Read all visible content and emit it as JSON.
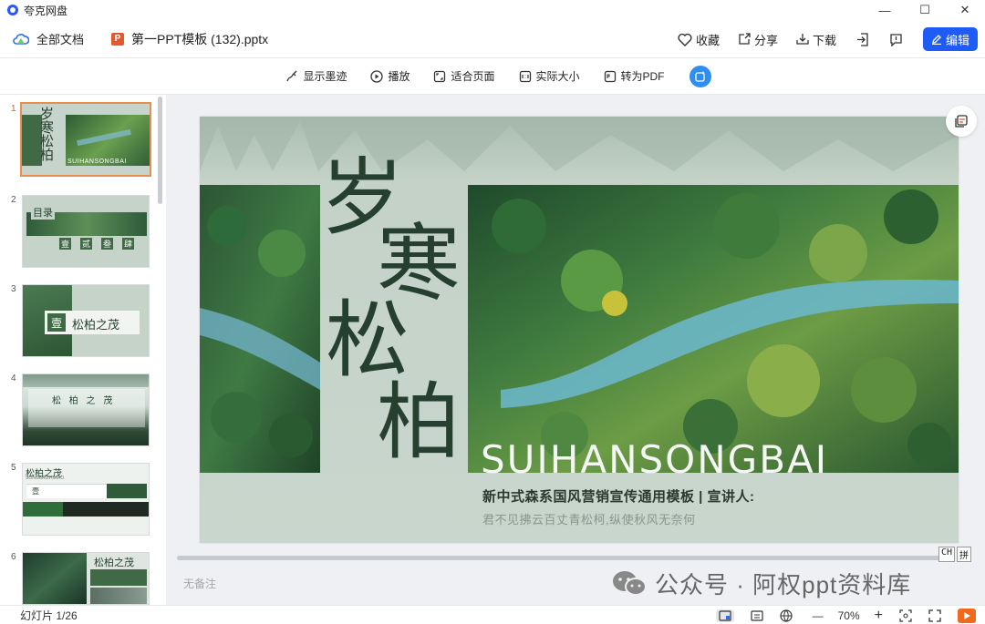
{
  "titlebar": {
    "app_name": "夸克网盘"
  },
  "window_controls": {
    "minimize": "—",
    "maximize": "☐",
    "close": "✕"
  },
  "header": {
    "all_docs": "全部文档",
    "file_name": "第一PPT模板 (132).pptx",
    "favorite": "收藏",
    "share": "分享",
    "download": "下载",
    "edit": "编辑"
  },
  "toolbar": {
    "show_ink": "显示墨迹",
    "play": "播放",
    "fit_page": "适合页面",
    "actual_size": "实际大小",
    "to_pdf": "转为PDF"
  },
  "thumbnails": [
    {
      "num": "1",
      "title": "岁寒松柏",
      "sub": "SUIHANSONGBAI",
      "active": true
    },
    {
      "num": "2",
      "title": "目录",
      "cells": [
        "壹",
        "贰",
        "叁",
        "肆"
      ]
    },
    {
      "num": "3",
      "title": "松柏之茂",
      "badge": "壹"
    },
    {
      "num": "4",
      "title": "松 柏 之 茂"
    },
    {
      "num": "5",
      "title": "松柏之茂",
      "sub": "SONGBAIZHIMAO",
      "badge": "壹"
    },
    {
      "num": "6",
      "title": "松柏之茂"
    }
  ],
  "slide": {
    "chars": [
      "岁",
      "寒",
      "松",
      "柏"
    ],
    "english": "SUIHANSONGBAI",
    "line1": "新中式森系国风营销宣传通用模板 | 宣讲人:",
    "line2": "君不见拂云百丈青松柯,纵使秋风无奈何"
  },
  "notes_placeholder": "无备注",
  "ime": {
    "mode1": "CH",
    "mode2": "拼"
  },
  "watermark": "公众号 · 阿权ppt资料库",
  "status": {
    "slide_count": "幻灯片 1/26",
    "zoom_minus": "—",
    "zoom_level": "70%",
    "zoom_plus": "+"
  },
  "colors": {
    "accent": "#1f5cf5",
    "active_thumb": "#e88e4f",
    "slide_bg": "#c7d4cb",
    "title_green": "#26402f"
  }
}
